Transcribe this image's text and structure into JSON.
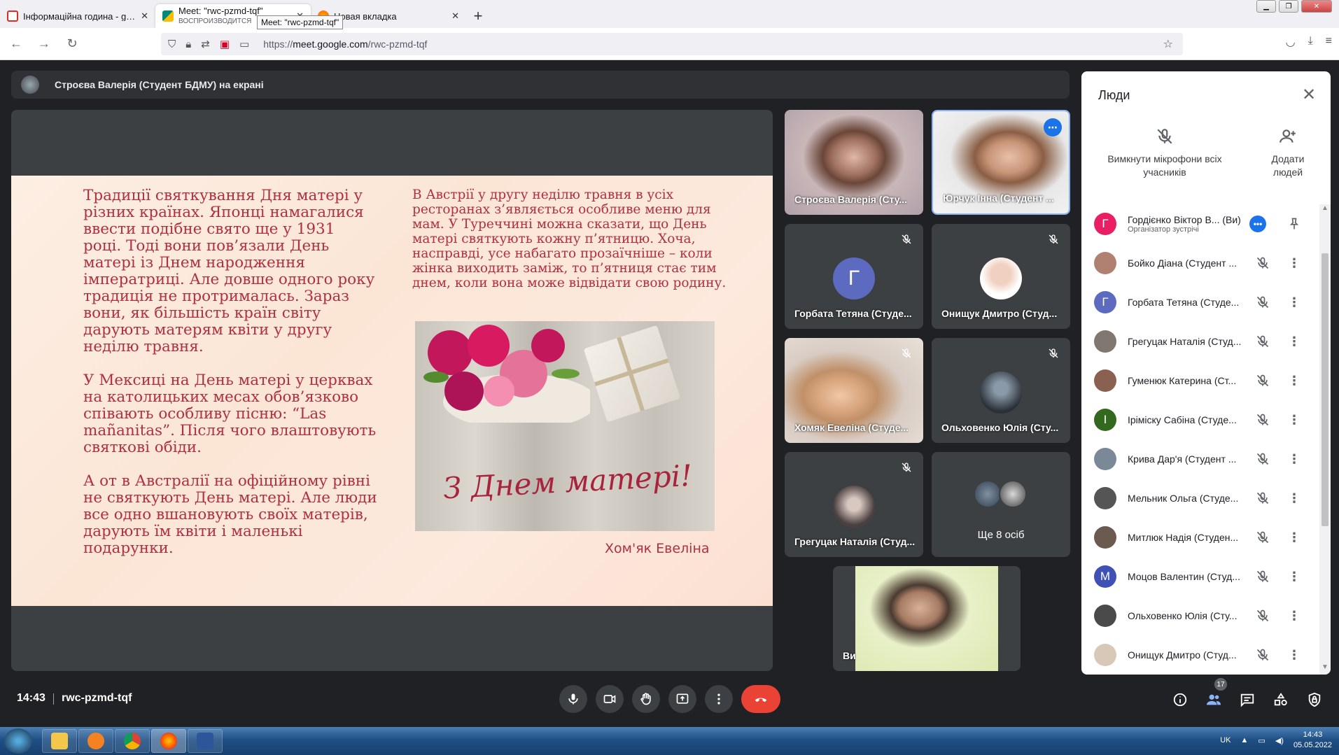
{
  "browser": {
    "tabs": [
      {
        "title": "Інформаційна година - gordie",
        "sub": "",
        "active": false,
        "icon_color": "#d93025"
      },
      {
        "title": "Meet: \"rwc-pzmd-tqf\"",
        "sub": "ВОСПРОИЗВОДИТСЯ",
        "active": true,
        "icon_color": "#00897b"
      },
      {
        "title": "Новая вкладка",
        "sub": "",
        "active": false,
        "icon_color": "#ff9500"
      }
    ],
    "tooltip": "Meet: \"rwc-pzmd-tqf\"",
    "url_prefix": "https://",
    "url_host": "meet.google.com",
    "url_path": "/rwc-pzmd-tqf"
  },
  "presenting_bar": {
    "text": "Строєва Валерія (Студент БДМУ) на екрані"
  },
  "slide": {
    "col1": [
      "Традиції святкування Дня матері у різних країнах. Японці намагалися ввести подібне свято ще у 1931 році. Тоді вони пов’язали День матері із Днем народження імператриці. Але довше одного року традиція не протрималась. Зараз вони, як більшість країн світу дарують матерям квіти у другу неділю травня.",
      "У Мексиці на День матері у церквах на католицьких месах обов’язково співають особливу пісню: “Las mañanitas”. Після чого влаштовують святкові обіди.",
      "А от в Австралії на офіційному рівні не святкують День матері. Але люди все одно вшановують своїх матерів, дарують їм квіти і маленькі подарунки."
    ],
    "col2": "В Австрії у другу неділю травня в усіх ресторанах з’являється особливе меню для мам. У Туреччині можна сказати, що День матері святкують кожну п’ятницю. Хоча, насправді, усе набагато прозаїчніше – коли жінка виходить заміж, то п’ятниця стає тим днем, коли вона може відвідати свою родину.",
    "photo_caption": "З Днем матері!",
    "author": "Хом'як Евеліна"
  },
  "tiles": [
    {
      "name": "Строєва Валерія (Сту...",
      "type": "video",
      "muted": false
    },
    {
      "name": "Юрчук Інна (Студент ...",
      "type": "video",
      "muted": false,
      "selected": true
    },
    {
      "name": "Горбата Тетяна (Студе...",
      "type": "avatar",
      "initial": "Г",
      "color": "#5c6bc0",
      "muted": true
    },
    {
      "name": "Онищук Дмитро (Студ...",
      "type": "photo",
      "muted": true
    },
    {
      "name": "Хомяк Евеліна (Студе...",
      "type": "video",
      "muted": true
    },
    {
      "name": "Ольховенко Юлія (Сту...",
      "type": "photo",
      "muted": true
    },
    {
      "name": "Грегуцак Наталія (Студ...",
      "type": "photo",
      "muted": true
    },
    {
      "name": "Ще 8 осіб",
      "type": "more"
    },
    {
      "name": "Ви",
      "type": "self"
    }
  ],
  "people_panel": {
    "title": "Люди",
    "mute_all": "Вимкнути мікрофони всіх учасників",
    "add_people": "Додати людей",
    "participants": [
      {
        "name": "Гордієнко Віктор В... (Ви)",
        "sub": "Організатор зустрічі",
        "initial": "Г",
        "color": "#e91e63",
        "host": true
      },
      {
        "name": "Бойко Діана (Студент ...",
        "initial": "",
        "color": "#b08070"
      },
      {
        "name": "Горбата Тетяна (Студе...",
        "initial": "Г",
        "color": "#5c6bc0"
      },
      {
        "name": "Грегуцак Наталія (Студ...",
        "initial": "",
        "color": "#807870"
      },
      {
        "name": "Гуменюк Катерина (Ст...",
        "initial": "",
        "color": "#8a6050"
      },
      {
        "name": "Іріміску Сабіна (Студе...",
        "initial": "І",
        "color": "#33691e"
      },
      {
        "name": "Крива Дар'я (Студент ...",
        "initial": "",
        "color": "#7a8898"
      },
      {
        "name": "Мельник Ольга (Студе...",
        "initial": "",
        "color": "#555"
      },
      {
        "name": "Митлюк Надія (Студен...",
        "initial": "",
        "color": "#6a5a50"
      },
      {
        "name": "Моцов Валентин (Студ...",
        "initial": "М",
        "color": "#3f51b5"
      },
      {
        "name": "Ольховенко Юлія (Сту...",
        "initial": "",
        "color": "#4a4a4a"
      },
      {
        "name": "Онищук Дмитро (Студ...",
        "initial": "",
        "color": "#d8c8b8"
      }
    ]
  },
  "bottom_bar": {
    "time": "14:43",
    "meeting_code": "rwc-pzmd-tqf",
    "people_count": "17"
  },
  "taskbar": {
    "lang": "UK",
    "time": "14:43",
    "date": "05.05.2022"
  }
}
